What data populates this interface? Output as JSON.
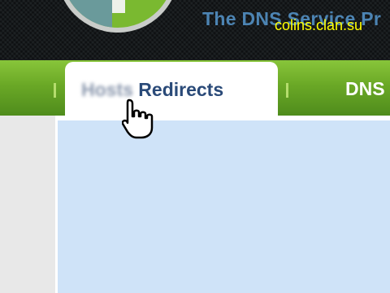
{
  "header": {
    "tagline": "The DNS Service Pr",
    "watermark": "colins.clan.su"
  },
  "nav": {
    "active_tab": {
      "label_blurred": "Hosts",
      "label": " Redirects"
    },
    "next_tab": {
      "label": "DNS"
    }
  },
  "colors": {
    "header_bg": "#15191b",
    "nav_green": "#6aa826",
    "tagline_blue": "#5fa8e6",
    "watermark_yellow": "#ffff00",
    "tab_text": "#2a4a78",
    "content_bg": "#cfe3f8"
  },
  "icons": {
    "logo": "dns-logo-icon",
    "cursor": "hand-pointer-cursor-icon"
  }
}
